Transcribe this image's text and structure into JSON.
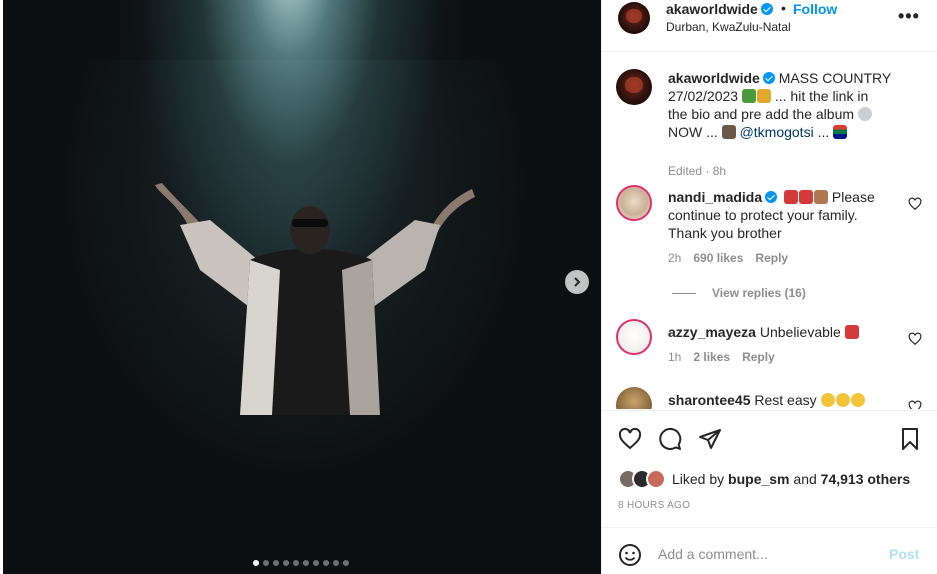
{
  "post": {
    "username": "aka​worldwide",
    "follow_label": "Follow",
    "separator": "•",
    "location": "Durban, KwaZulu-Natal",
    "more_label": "•••",
    "carousel": {
      "total_slides": 10,
      "active_index": 0
    }
  },
  "caption": {
    "username": "akaworldwide",
    "line1": "MASS COUNTRY",
    "line2a": "27/02/2023",
    "line2b": "... hit the link in",
    "line3": "the bio and pre add the album",
    "line4a": "NOW ...",
    "mention": "@tkmogotsi",
    "line4b": "...",
    "edited": "Edited",
    "time": "8h"
  },
  "comments": [
    {
      "username": "nandi_madida",
      "text_line1": "Please",
      "text_line2": "continue to protect your family.",
      "text_line3": "Thank you brother",
      "time": "2h",
      "likes": "690 likes",
      "reply": "Reply",
      "view_replies": "View replies (16)"
    },
    {
      "username": "azzy_mayeza",
      "text": "Unbelievable",
      "time": "1h",
      "likes": "2 likes",
      "reply": "Reply"
    },
    {
      "username": "sharontee45",
      "text": "Rest easy"
    }
  ],
  "engagement": {
    "liked_by_prefix": "Liked by",
    "liked_by_user": "bupe_sm",
    "and": "and",
    "others": "74,913 others",
    "time_ago": "8 HOURS AGO"
  },
  "composer": {
    "placeholder": "Add a comment...",
    "post_label": "Post"
  },
  "icons": {
    "like": "heart-icon",
    "comment": "comment-icon",
    "share": "share-icon",
    "save": "bookmark-icon",
    "emoji": "smiley-icon",
    "next": "chevron-right-icon"
  },
  "colors": {
    "accent": "#0095f6",
    "post_disabled": "#b2dffc",
    "muted": "#8e8e8e",
    "text": "#262626"
  }
}
